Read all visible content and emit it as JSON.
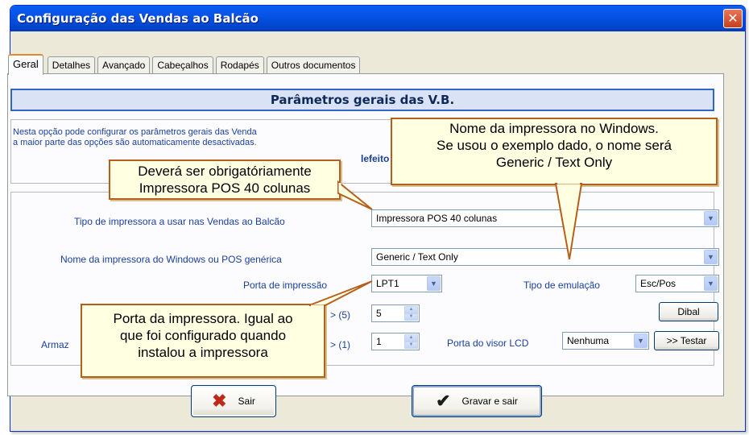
{
  "window": {
    "title": "Configuração das Vendas ao Balcão",
    "close_label": "✕"
  },
  "tabs": [
    {
      "label": "Geral"
    },
    {
      "label": "Detalhes"
    },
    {
      "label": "Avançado"
    },
    {
      "label": "Cabeçalhos"
    },
    {
      "label": "Rodapés"
    },
    {
      "label": "Outros documentos"
    }
  ],
  "header": {
    "title": "Parâmetros gerais das V.B."
  },
  "info": {
    "line1": "Nesta opção pode configurar os parâmetros gerais das Venda",
    "line2": "a maior parte das opções são automaticamente desactivadas.",
    "bold_fragment": "lefeito"
  },
  "form": {
    "printer_type": {
      "label": "Tipo de impressora a usar nas Vendas ao Balcão",
      "value": "Impressora POS 40 colunas"
    },
    "printer_name": {
      "label": "Nome da impressora do Windows ou POS genérica",
      "value": "Generic / Text Only"
    },
    "port": {
      "label": "Porta de impressão",
      "value": "LPT1"
    },
    "emulation": {
      "label": "Tipo de emulação",
      "value": "Esc/Pos"
    },
    "row5": {
      "label_suffix": "> (5)",
      "value": "5"
    },
    "row6": {
      "label_prefix": "Armaz",
      "label_suffix": "> (1)",
      "value": "1"
    },
    "dibal_button": "Dibal",
    "lcd": {
      "label": "Porta do visor LCD",
      "value": "Nenhuma"
    },
    "test_button": ">> Testar"
  },
  "buttons": {
    "exit": "Sair",
    "save_exit": "Gravar e sair"
  },
  "callouts": {
    "printer_name_note": [
      "Nome da impressora no Windows.",
      "Se usou o exemplo dado, o nome será",
      "Generic / Text Only"
    ],
    "printer_type_note": [
      "Deverá ser obrigatóriamente",
      "Impressora POS 40 colunas"
    ],
    "port_note": [
      "Porta da impressora. Igual ao",
      "que foi configurado quando",
      "instalou a impressora"
    ]
  },
  "colors": {
    "title_bar": "#0653e6",
    "label_text": "#1a3e9c",
    "callout_bg": "#ffffe1",
    "callout_border": "#b4601c",
    "close_red": "#c6401e"
  },
  "icons": {
    "close": "close-icon",
    "combo": "chevron-down-icon",
    "exit": "x-icon",
    "save": "checkmark-icon"
  }
}
